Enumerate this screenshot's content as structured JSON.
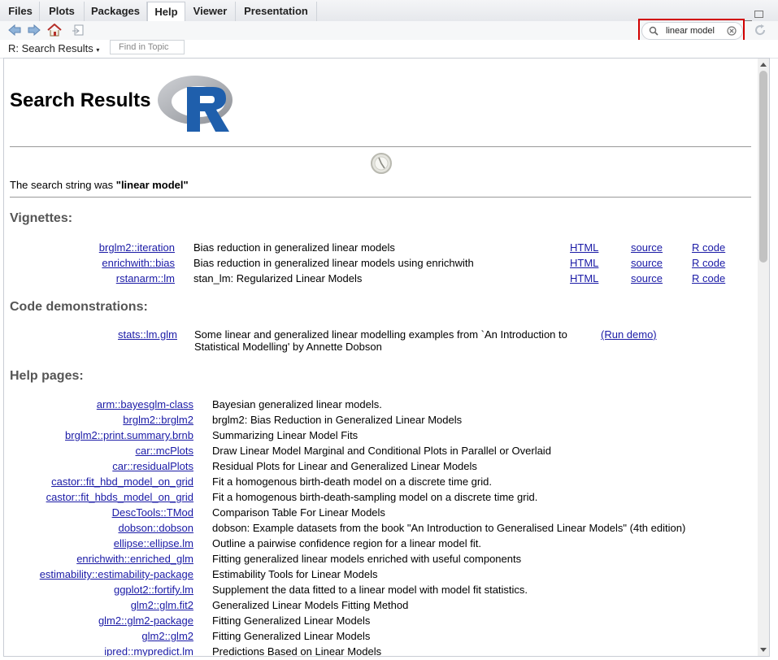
{
  "tabs": [
    {
      "label": "Files"
    },
    {
      "label": "Plots"
    },
    {
      "label": "Packages"
    },
    {
      "label": "Help"
    },
    {
      "label": "Viewer"
    },
    {
      "label": "Presentation"
    }
  ],
  "toolbar": {
    "search_value": "linear model"
  },
  "topic_bar": {
    "title": "R: Search Results",
    "find_placeholder": "Find in Topic"
  },
  "page": {
    "heading": "Search Results",
    "search_string_prefix": "The search string was ",
    "search_string": "\"linear model\"",
    "vignettes_heading": "Vignettes:",
    "demos_heading": "Code demonstrations:",
    "help_heading": "Help pages:"
  },
  "vignettes": [
    {
      "name": "brglm2::iteration",
      "desc": "Bias reduction in generalized linear models",
      "html": "HTML",
      "source": "source",
      "rcode": "R code"
    },
    {
      "name": "enrichwith::bias",
      "desc": "Bias reduction in generalized linear models using enrichwith",
      "html": "HTML",
      "source": "source",
      "rcode": "R code"
    },
    {
      "name": "rstanarm::lm",
      "desc": "stan_lm: Regularized Linear Models",
      "html": "HTML",
      "source": "source",
      "rcode": "R code"
    }
  ],
  "demo": {
    "name": "stats::lm.glm",
    "desc": "Some linear and generalized linear modelling examples from `An Introduction to Statistical Modelling' by Annette Dobson",
    "run": "(Run demo)"
  },
  "help_pages": [
    {
      "name": "arm::bayesglm-class",
      "desc": "Bayesian generalized linear models."
    },
    {
      "name": "brglm2::brglm2",
      "desc": "brglm2: Bias Reduction in Generalized Linear Models"
    },
    {
      "name": "brglm2::print.summary.brnb",
      "desc": "Summarizing Linear Model Fits"
    },
    {
      "name": "car::mcPlots",
      "desc": "Draw Linear Model Marginal and Conditional Plots in Parallel or Overlaid"
    },
    {
      "name": "car::residualPlots",
      "desc": "Residual Plots for Linear and Generalized Linear Models"
    },
    {
      "name": "castor::fit_hbd_model_on_grid",
      "desc": "Fit a homogenous birth-death model on a discrete time grid."
    },
    {
      "name": "castor::fit_hbds_model_on_grid",
      "desc": "Fit a homogenous birth-death-sampling model on a discrete time grid."
    },
    {
      "name": "DescTools::TMod",
      "desc": "Comparison Table For Linear Models"
    },
    {
      "name": "dobson::dobson",
      "desc": "dobson: Example datasets from the book \"An Introduction to Generalised Linear Models\" (4th edition)"
    },
    {
      "name": "ellipse::ellipse.lm",
      "desc": "Outline a pairwise confidence region for a linear model fit."
    },
    {
      "name": "enrichwith::enriched_glm",
      "desc": "Fitting generalized linear models enriched with useful components"
    },
    {
      "name": "estimability::estimability-package",
      "desc": "Estimability Tools for Linear Models"
    },
    {
      "name": "ggplot2::fortify.lm",
      "desc": "Supplement the data fitted to a linear model with model fit statistics."
    },
    {
      "name": "glm2::glm.fit2",
      "desc": "Generalized Linear Models Fitting Method"
    },
    {
      "name": "glm2::glm2-package",
      "desc": "Fitting Generalized Linear Models"
    },
    {
      "name": "glm2::glm2",
      "desc": "Fitting Generalized Linear Models"
    },
    {
      "name": "ipred::mypredict.lm",
      "desc": "Predictions Based on Linear Models"
    }
  ],
  "colors": {
    "link": "#1a1aa6",
    "highlight": "#d10000",
    "r_logo_blue": "#1f5fac",
    "r_logo_gray": "#9a9da3"
  },
  "icons": [
    "back-arrow-icon",
    "forward-arrow-icon",
    "home-icon",
    "print-icon",
    "search-icon",
    "clear-search-icon",
    "refresh-icon",
    "r-logo",
    "loading-spinner-icon"
  ]
}
